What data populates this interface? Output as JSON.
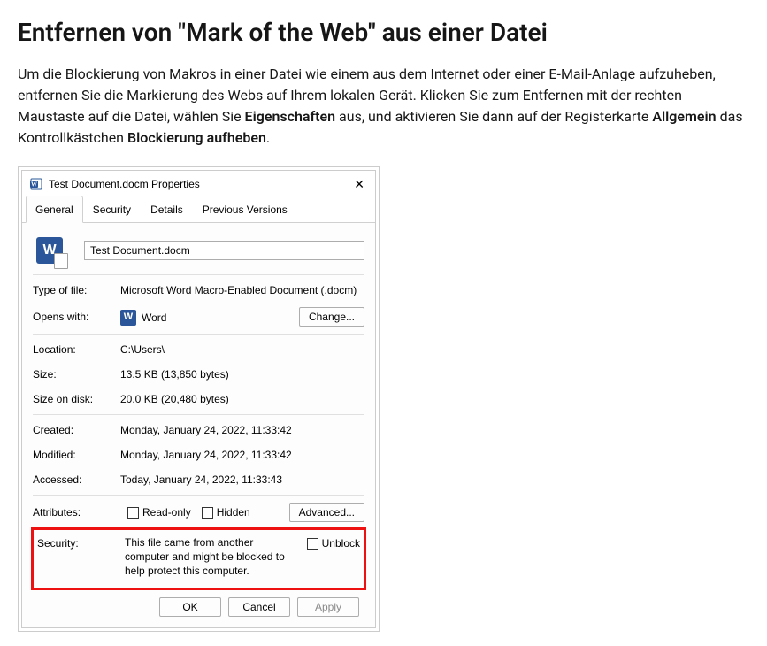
{
  "heading": "Entfernen von \"Mark of the Web\" aus einer Datei",
  "intro": {
    "p1a": "Um die Blockierung von Makros in einer Datei wie einem aus dem Internet oder einer E-Mail-Anlage aufzuheben, entfernen Sie die Markierung des Webs auf Ihrem lokalen Gerät. Klicken Sie zum Entfernen mit der rechten Maustaste auf die Datei, wählen Sie ",
    "b1": "Eigenschaften",
    "p1b": " aus, und aktivieren Sie dann auf der Registerkarte ",
    "b2": "Allgemein",
    "p1c": " das Kontrollkästchen ",
    "b3": "Blockierung aufheben",
    "p1d": "."
  },
  "dialog": {
    "title": "Test Document.docm Properties",
    "close": "✕",
    "tabs": {
      "general": "General",
      "security": "Security",
      "details": "Details",
      "previous": "Previous Versions"
    },
    "filename": "Test Document.docm",
    "labels": {
      "type": "Type of file:",
      "opens": "Opens with:",
      "location": "Location:",
      "size": "Size:",
      "sizeod": "Size on disk:",
      "created": "Created:",
      "modified": "Modified:",
      "accessed": "Accessed:",
      "attributes": "Attributes:",
      "security": "Security:"
    },
    "values": {
      "type": "Microsoft Word Macro-Enabled Document (.docm)",
      "opens": "Word",
      "location": "C:\\Users\\",
      "size": "13.5 KB (13,850 bytes)",
      "sizeod": "20.0 KB (20,480 bytes)",
      "created": "Monday, January 24, 2022, 11:33:42",
      "modified": "Monday, January 24, 2022, 11:33:42",
      "accessed": "Today, January 24, 2022, 11:33:43",
      "security_msg": "This file came from another computer and might be blocked to help protect this computer."
    },
    "buttons": {
      "change": "Change...",
      "advanced": "Advanced...",
      "ok": "OK",
      "cancel": "Cancel",
      "apply": "Apply"
    },
    "checkboxes": {
      "readonly": "Read-only",
      "hidden": "Hidden",
      "unblock": "Unblock"
    },
    "big_icon_letter": "W",
    "app_icon_letter": "W"
  }
}
